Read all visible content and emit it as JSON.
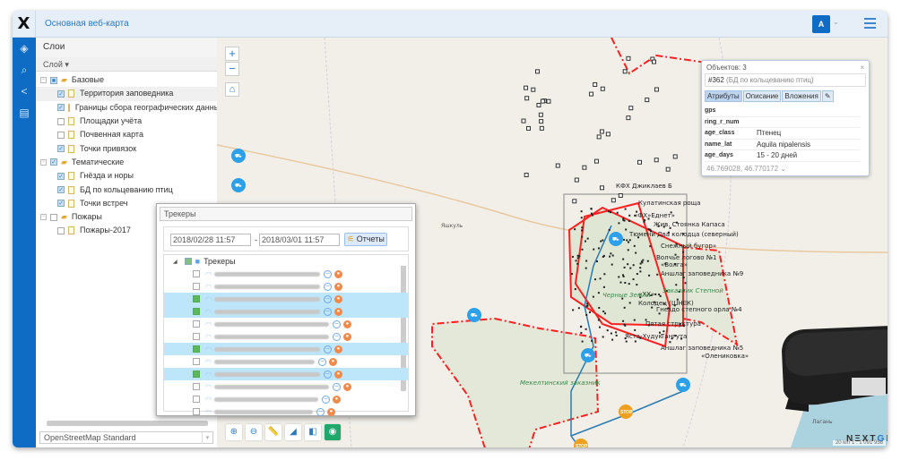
{
  "header": {
    "logo": "X",
    "title": "Основная веб-карта",
    "avatar": "A",
    "chevron": "⌄"
  },
  "rail": [
    {
      "icon": "layers-icon",
      "glyph": "◈"
    },
    {
      "icon": "search-icon",
      "glyph": "⌕"
    },
    {
      "icon": "share-icon",
      "glyph": "<"
    },
    {
      "icon": "print-icon",
      "glyph": "▤"
    }
  ],
  "layers": {
    "title": "Слои",
    "column": "Слой ▾",
    "items": [
      {
        "label": "Базовые",
        "type": "group",
        "checked": "partial"
      },
      {
        "label": "Территория заповедника",
        "type": "layer",
        "checked": true
      },
      {
        "label": "Границы сбора географических данных",
        "type": "layer",
        "checked": true
      },
      {
        "label": "Площадки учёта",
        "type": "layer",
        "checked": false
      },
      {
        "label": "Почвенная карта",
        "type": "layer",
        "checked": false
      },
      {
        "label": "Точки привязок",
        "type": "layer",
        "checked": true
      },
      {
        "label": "Тематические",
        "type": "group",
        "checked": true
      },
      {
        "label": "Гнёзда и норы",
        "type": "layer",
        "checked": true
      },
      {
        "label": "БД по кольцеванию птиц",
        "type": "layer",
        "checked": true
      },
      {
        "label": "Точки встреч",
        "type": "layer",
        "checked": true
      },
      {
        "label": "Пожары",
        "type": "group",
        "checked": false
      },
      {
        "label": "Пожары-2017",
        "type": "layer",
        "checked": false
      }
    ],
    "basemap": "OpenStreetMap Standard"
  },
  "map": {
    "zoom_in": "+",
    "zoom_out": "−",
    "home": "⌂",
    "labels": [
      "КФХ Джиклаев Б",
      "Кулатинская роща",
      "«ФХ»Еднет»",
      "Жив. Стоянка Капаса",
      "Тюмени Два колодца (северный)",
      "Снежный бугор»",
      "Волчье логово №1",
      "«Волга»",
      "Аншлаг заповедника №9",
      "«ХХ»",
      "Колодец (ШНЕК)",
      "Гнездо степного орла №4",
      "Пятая структура",
      "Яста-Худук",
      "Тангута",
      "Аншлаг заповедника №5",
      "«Олениковка»"
    ],
    "green_labels": [
      "Черные Земли",
      "Заказник Степной",
      "Мекелтинский заказник"
    ],
    "small_labels": [
      "Яшкуль",
      "Лагань"
    ],
    "scale": "20 km   1 : 1 091 958",
    "stop": "STOP"
  },
  "tools": [
    {
      "icon": "zoom-in-icon",
      "glyph": "⊕"
    },
    {
      "icon": "zoom-out-icon",
      "glyph": "⊖"
    },
    {
      "icon": "ruler-icon",
      "glyph": "📏"
    },
    {
      "icon": "area-measure-icon",
      "glyph": "◢"
    },
    {
      "icon": "swipe-icon",
      "glyph": "◧"
    },
    {
      "icon": "tracker-icon",
      "glyph": "◉"
    }
  ],
  "popup": {
    "title": "Объектов: 3",
    "close": "×",
    "feature_id": "#362",
    "feature_layer": "(БД по кольцеванию птиц)",
    "tabs": [
      "Атрибуты",
      "Описание",
      "Вложения"
    ],
    "attributes": [
      {
        "k": "gps",
        "v": ""
      },
      {
        "k": "ring_r_num",
        "v": ""
      },
      {
        "k": "age_class",
        "v": "Птенец"
      },
      {
        "k": "name_lat",
        "v": "Aquila nipalensis"
      },
      {
        "k": "age_days",
        "v": "15 - 20 дней"
      }
    ],
    "coords": "46.769028, 46.770172 ⌄"
  },
  "trackers": {
    "title": "Трекеры",
    "date_from": "2018/02/28 11:57",
    "date_sep": "-",
    "date_to": "2018/03/01 11:57",
    "reports": "Отчеты",
    "root": "Трекеры",
    "rows": [
      {
        "checked": false,
        "w": 118
      },
      {
        "checked": false,
        "w": 118
      },
      {
        "checked": true,
        "w": 118
      },
      {
        "checked": true,
        "w": 118
      },
      {
        "checked": false,
        "w": 128
      },
      {
        "checked": false,
        "w": 128
      },
      {
        "checked": true,
        "w": 118
      },
      {
        "checked": false,
        "w": 112
      },
      {
        "checked": true,
        "w": 118
      },
      {
        "checked": false,
        "w": 128
      },
      {
        "checked": false,
        "w": 116
      },
      {
        "checked": false,
        "w": 110
      }
    ]
  },
  "branding": {
    "n": "N",
    "e": "ΞXT",
    "gis": "GIS"
  },
  "colors": {
    "accent": "#0f6cc5",
    "boundary": "#ff2020",
    "tracker": "#2ca0e8",
    "stop": "#f0a020"
  }
}
